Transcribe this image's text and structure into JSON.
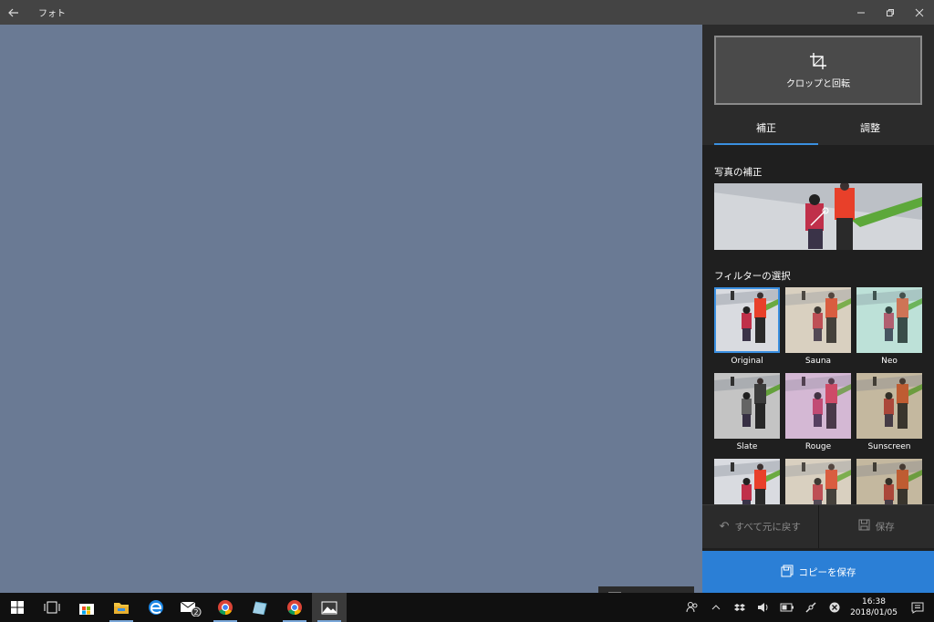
{
  "window": {
    "title": "フォト",
    "back_icon": "back-arrow-icon",
    "minimize_icon": "minimize-icon",
    "restore_icon": "restore-icon",
    "close_icon": "close-icon"
  },
  "canvas": {
    "background": "#6a7a94",
    "zoom": {
      "fit_icon": "fit-to-window-icon",
      "minus": "−",
      "plus": "+"
    }
  },
  "panel": {
    "crop_button_label": "クロップと回転",
    "tabs": [
      {
        "label": "補正",
        "active": true
      },
      {
        "label": "調整",
        "active": false
      }
    ],
    "enhance_label": "写真の補正",
    "filters_label": "フィルターの選択",
    "filters": [
      {
        "name": "Original",
        "selected": true,
        "tint": "none"
      },
      {
        "name": "Sauna",
        "selected": false,
        "tint": "sauna"
      },
      {
        "name": "Neo",
        "selected": false,
        "tint": "neo"
      },
      {
        "name": "Slate",
        "selected": false,
        "tint": "slate"
      },
      {
        "name": "Rouge",
        "selected": false,
        "tint": "rouge"
      },
      {
        "name": "Sunscreen",
        "selected": false,
        "tint": "sunscreen"
      },
      {
        "name": "",
        "selected": false,
        "tint": "none"
      },
      {
        "name": "",
        "selected": false,
        "tint": "sauna"
      },
      {
        "name": "",
        "selected": false,
        "tint": "sunscreen"
      }
    ],
    "revert_label": "すべて元に戻す",
    "save_label": "保存",
    "save_copy_label": "コピーを保存",
    "accent": "#2b7fd6"
  },
  "taskbar": {
    "apps": [
      {
        "name": "start-icon"
      },
      {
        "name": "task-view-icon"
      },
      {
        "name": "store-icon"
      },
      {
        "name": "file-explorer-icon"
      },
      {
        "name": "edge-icon"
      },
      {
        "name": "mail-icon",
        "badge": "2"
      },
      {
        "name": "chrome-icon"
      },
      {
        "name": "app-icon"
      },
      {
        "name": "chrome-icon-2"
      },
      {
        "name": "photos-icon"
      }
    ],
    "clock": {
      "time": "16:38",
      "date": "2018/01/05"
    }
  }
}
